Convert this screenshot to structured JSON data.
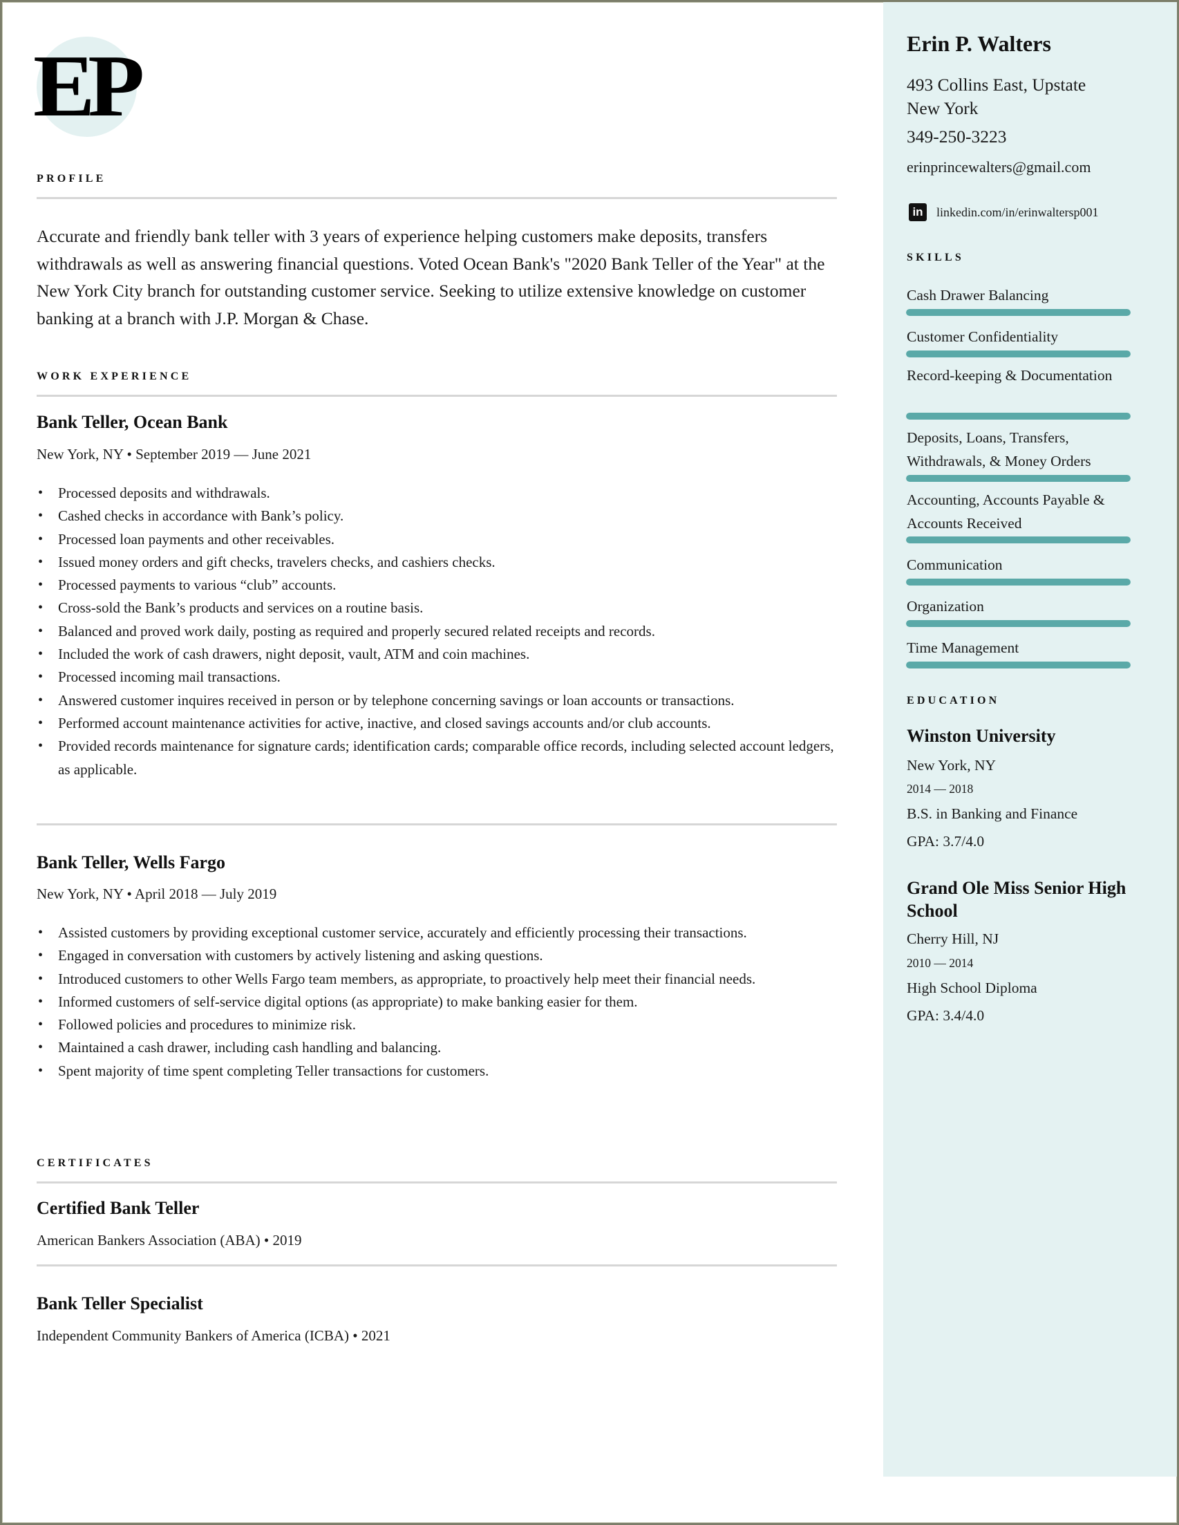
{
  "monogram": "EP",
  "colors": {
    "sidebar_bg": "#e4f2f2",
    "skill_bar": "#5aa9a8",
    "rule": "#d6d6d6",
    "monogram_circle": "#e3f1f1"
  },
  "profile": {
    "label": "PROFILE",
    "text": "Accurate and friendly bank teller with 3 years of experience helping customers make deposits, transfers withdrawals as well as answering financial questions. Voted Ocean Bank's \"2020 Bank Teller of the Year\" at the New York City branch for outstanding customer service. Seeking to utilize extensive knowledge on customer banking at a branch with J.P. Morgan & Chase."
  },
  "work_experience": {
    "label": "WORK EXPERIENCE",
    "jobs": [
      {
        "title": "Bank Teller, Ocean Bank",
        "meta": "New York, NY • September 2019 — June 2021",
        "bullets": [
          "Processed deposits and withdrawals.",
          "Cashed checks in accordance with Bank’s policy.",
          "Processed loan payments and other receivables.",
          "Issued money orders and gift checks, travelers checks, and cashiers checks.",
          "Processed payments to various “club” accounts.",
          "Cross-sold the Bank’s products and services on a routine basis.",
          "Balanced and proved work daily, posting as required and properly secured related receipts and records.",
          "Included the work of cash drawers, night deposit, vault, ATM and coin machines.",
          "Processed incoming mail transactions.",
          "Answered customer inquires received in person or by telephone concerning savings or loan accounts or transactions.",
          "Performed account maintenance activities for active, inactive, and closed savings accounts and/or club accounts.",
          "Provided records maintenance for signature cards; identification cards; comparable office records, including selected account ledgers, as applicable."
        ]
      },
      {
        "title": "Bank Teller, Wells Fargo",
        "meta": "New York, NY • April 2018 — July 2019",
        "bullets": [
          "Assisted customers by providing exceptional customer service, accurately and efficiently processing their transactions.",
          "Engaged in conversation with customers by actively listening and asking questions.",
          "Introduced customers to other Wells Fargo team members, as appropriate, to proactively help meet their financial needs.",
          "Informed customers of self-service digital options (as appropriate) to make banking easier for them.",
          "Followed policies and procedures to minimize risk.",
          "Maintained a cash drawer, including cash handling and balancing.",
          "Spent majority of time spent completing Teller transactions for customers."
        ]
      }
    ]
  },
  "certificates": {
    "label": "CERTIFICATES",
    "items": [
      {
        "title": "Certified Bank Teller",
        "meta": "American Bankers Association (ABA) • 2019"
      },
      {
        "title": "Bank Teller Specialist",
        "meta": "Independent Community Bankers of America (ICBA) • 2021"
      }
    ]
  },
  "sidebar": {
    "name": "Erin P. Walters",
    "address_line1": "493 Collins East, Upstate",
    "address_line2": "New York",
    "phone": "349-250-3223",
    "email": "erinprincewalters@gmail.com",
    "linkedin_icon": "in",
    "linkedin": "linkedin.com/in/erinwaltersp001",
    "skills_label": "SKILLS",
    "skills": [
      {
        "name": "Cash Drawer Balancing",
        "level": 1.0
      },
      {
        "name": "Customer Confidentiality",
        "level": 1.0
      },
      {
        "name": "Record-keeping & Documentation",
        "level": 1.0
      },
      {
        "name": "Deposits, Loans, Transfers, Withdrawals, & Money Orders",
        "level": 1.0
      },
      {
        "name": "Accounting, Accounts Payable & Accounts Received",
        "level": 1.0
      },
      {
        "name": "Communication",
        "level": 1.0
      },
      {
        "name": "Organization",
        "level": 1.0
      },
      {
        "name": "Time Management",
        "level": 1.0
      }
    ],
    "education_label": "EDUCATION",
    "education": [
      {
        "school": "Winston University",
        "location": "New York, NY",
        "years": "2014 — 2018",
        "degree": "B.S. in Banking and Finance",
        "gpa": "GPA: 3.7/4.0"
      },
      {
        "school": "Grand Ole Miss Senior High School",
        "location": "Cherry Hill, NJ",
        "years": "2010 — 2014",
        "degree": "High School Diploma",
        "gpa": "GPA: 3.4/4.0"
      }
    ]
  }
}
